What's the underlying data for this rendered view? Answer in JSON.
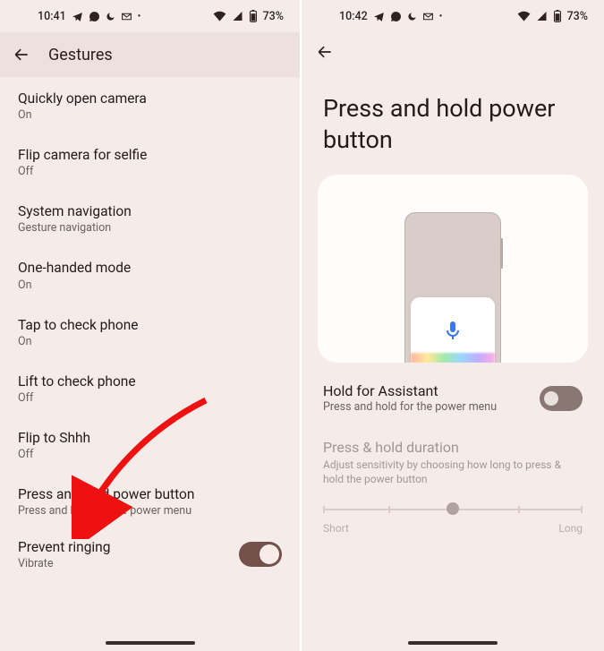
{
  "left": {
    "status": {
      "time": "10:41",
      "battery": "73%"
    },
    "header": {
      "title": "Gestures"
    },
    "items": [
      {
        "title": "Quickly open camera",
        "sub": "On"
      },
      {
        "title": "Flip camera for selfie",
        "sub": "Off"
      },
      {
        "title": "System navigation",
        "sub": "Gesture navigation"
      },
      {
        "title": "One-handed mode",
        "sub": "On"
      },
      {
        "title": "Tap to check phone",
        "sub": "On"
      },
      {
        "title": "Lift to check phone",
        "sub": "Off"
      },
      {
        "title": "Flip to Shhh",
        "sub": "Off"
      },
      {
        "title": "Press and hold power button",
        "sub": "Press and hold for the power menu"
      }
    ],
    "prevent_ringing": {
      "title": "Prevent ringing",
      "sub": "Vibrate",
      "on": true
    }
  },
  "right": {
    "status": {
      "time": "10:42",
      "battery": "73%"
    },
    "page_title": "Press and hold power button",
    "hold_assistant": {
      "title": "Hold for Assistant",
      "sub": "Press and hold for the power menu",
      "on": false
    },
    "duration": {
      "title": "Press & hold duration",
      "sub": "Adjust sensitivity by choosing how long to press & hold the power button",
      "label_short": "Short",
      "label_long": "Long"
    }
  },
  "icons": {
    "telegram": "telegram-icon",
    "whatsapp": "whatsapp-icon",
    "moon": "moon-icon",
    "mail": "mail-icon",
    "dot": "dot-icon",
    "wifi": "wifi-icon",
    "signal": "signal-icon",
    "battery": "battery-icon",
    "mic": "mic-icon"
  }
}
